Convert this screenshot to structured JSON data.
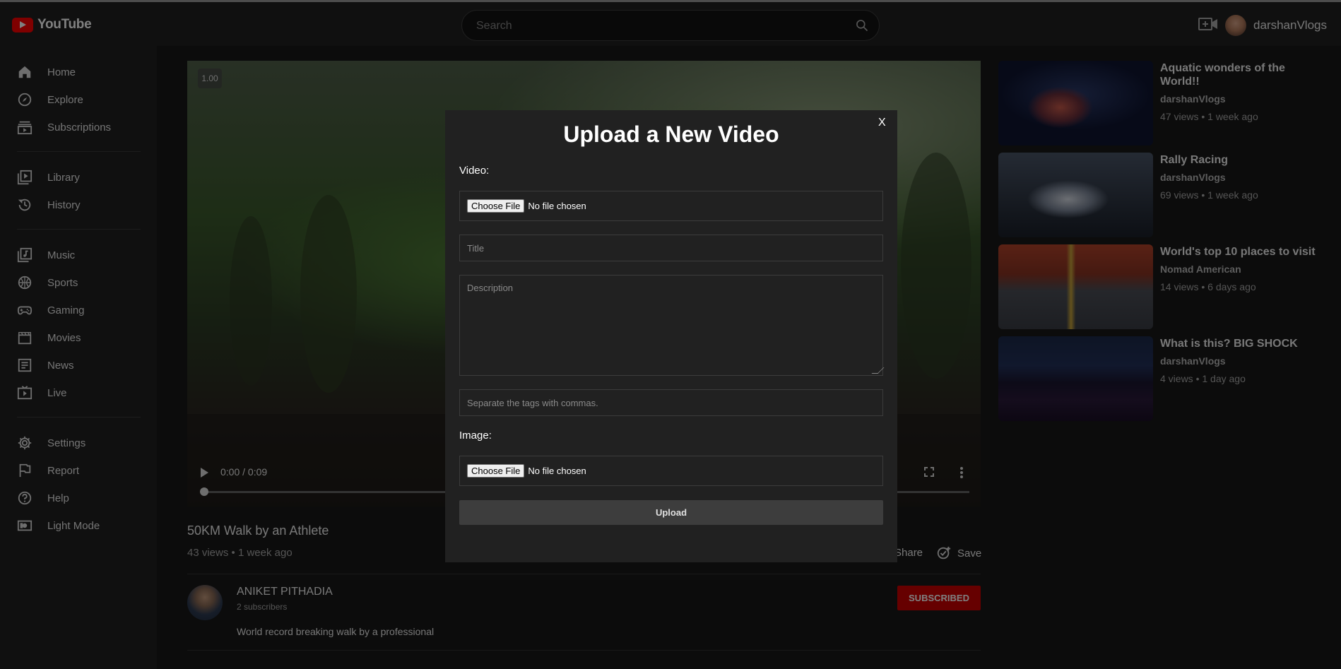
{
  "app": {
    "name": "YouTube"
  },
  "header": {
    "search_placeholder": "Search",
    "username": "darshanVlogs"
  },
  "sidebar": {
    "group1": [
      {
        "label": "Home"
      },
      {
        "label": "Explore"
      },
      {
        "label": "Subscriptions"
      }
    ],
    "group2": [
      {
        "label": "Library"
      },
      {
        "label": "History"
      }
    ],
    "group3": [
      {
        "label": "Music"
      },
      {
        "label": "Sports"
      },
      {
        "label": "Gaming"
      },
      {
        "label": "Movies"
      },
      {
        "label": "News"
      },
      {
        "label": "Live"
      }
    ],
    "group4": [
      {
        "label": "Settings"
      },
      {
        "label": "Report"
      },
      {
        "label": "Help"
      },
      {
        "label": "Light Mode"
      }
    ]
  },
  "player": {
    "speed": "1.00",
    "time": "0:00 / 0:09"
  },
  "video": {
    "title": "50KM Walk by an Athlete",
    "meta": "43 views • 1 week ago",
    "share_label": "Share",
    "save_label": "Save"
  },
  "channel": {
    "name": "ANIKET PITHADIA",
    "subscribers": "2 subscribers",
    "description": "World record breaking walk by a professional",
    "subscribe_label": "SUBSCRIBED"
  },
  "recommendations": [
    {
      "title": "Aquatic wonders of the World!!",
      "channel": "darshanVlogs",
      "meta": "47 views • 1 week ago"
    },
    {
      "title": "Rally Racing",
      "channel": "darshanVlogs",
      "meta": "69 views • 1 week ago"
    },
    {
      "title": "World's top 10 places to visit",
      "channel": "Nomad American",
      "meta": "14 views • 6 days ago"
    },
    {
      "title": "What is this? BIG SHOCK",
      "channel": "darshanVlogs",
      "meta": "4 views • 1 day ago"
    }
  ],
  "modal": {
    "close_label": "X",
    "title": "Upload a New Video",
    "video_label": "Video:",
    "choose_file": "Choose File",
    "no_file": "No file chosen",
    "title_placeholder": "Title",
    "description_placeholder": "Description",
    "tags_placeholder": "Separate the tags with commas.",
    "image_label": "Image:",
    "upload_label": "Upload"
  }
}
